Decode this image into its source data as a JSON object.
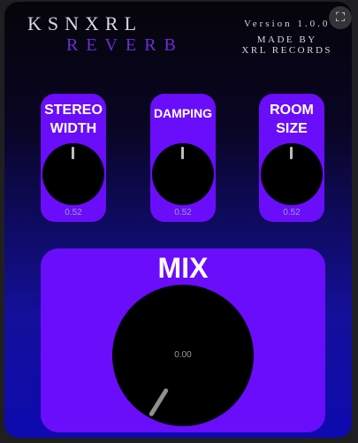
{
  "header": {
    "brand_name": "KSNXRL",
    "brand_sub": "REVERB",
    "version": "Version 1.0.0",
    "made_by_line1": "MADE BY",
    "made_by_line2": "XRL RECORDS"
  },
  "controls": {
    "expand_icon": "expand-icon",
    "expand_glyph": "⛶"
  },
  "knobs": [
    {
      "label_line1": "STEREO",
      "label_line2": "WIDTH",
      "value": "0.52"
    },
    {
      "label_line1": "DAMPING",
      "label_line2": "",
      "value": "0.52"
    },
    {
      "label_line1": "ROOM",
      "label_line2": "SIZE",
      "value": "0.52"
    }
  ],
  "mix": {
    "label": "MIX",
    "value": "0.00"
  },
  "colors": {
    "panel": "#6a0dfa",
    "brand_sub": "#6b2ed6",
    "gradient_bottom": "#0d0ab0"
  }
}
